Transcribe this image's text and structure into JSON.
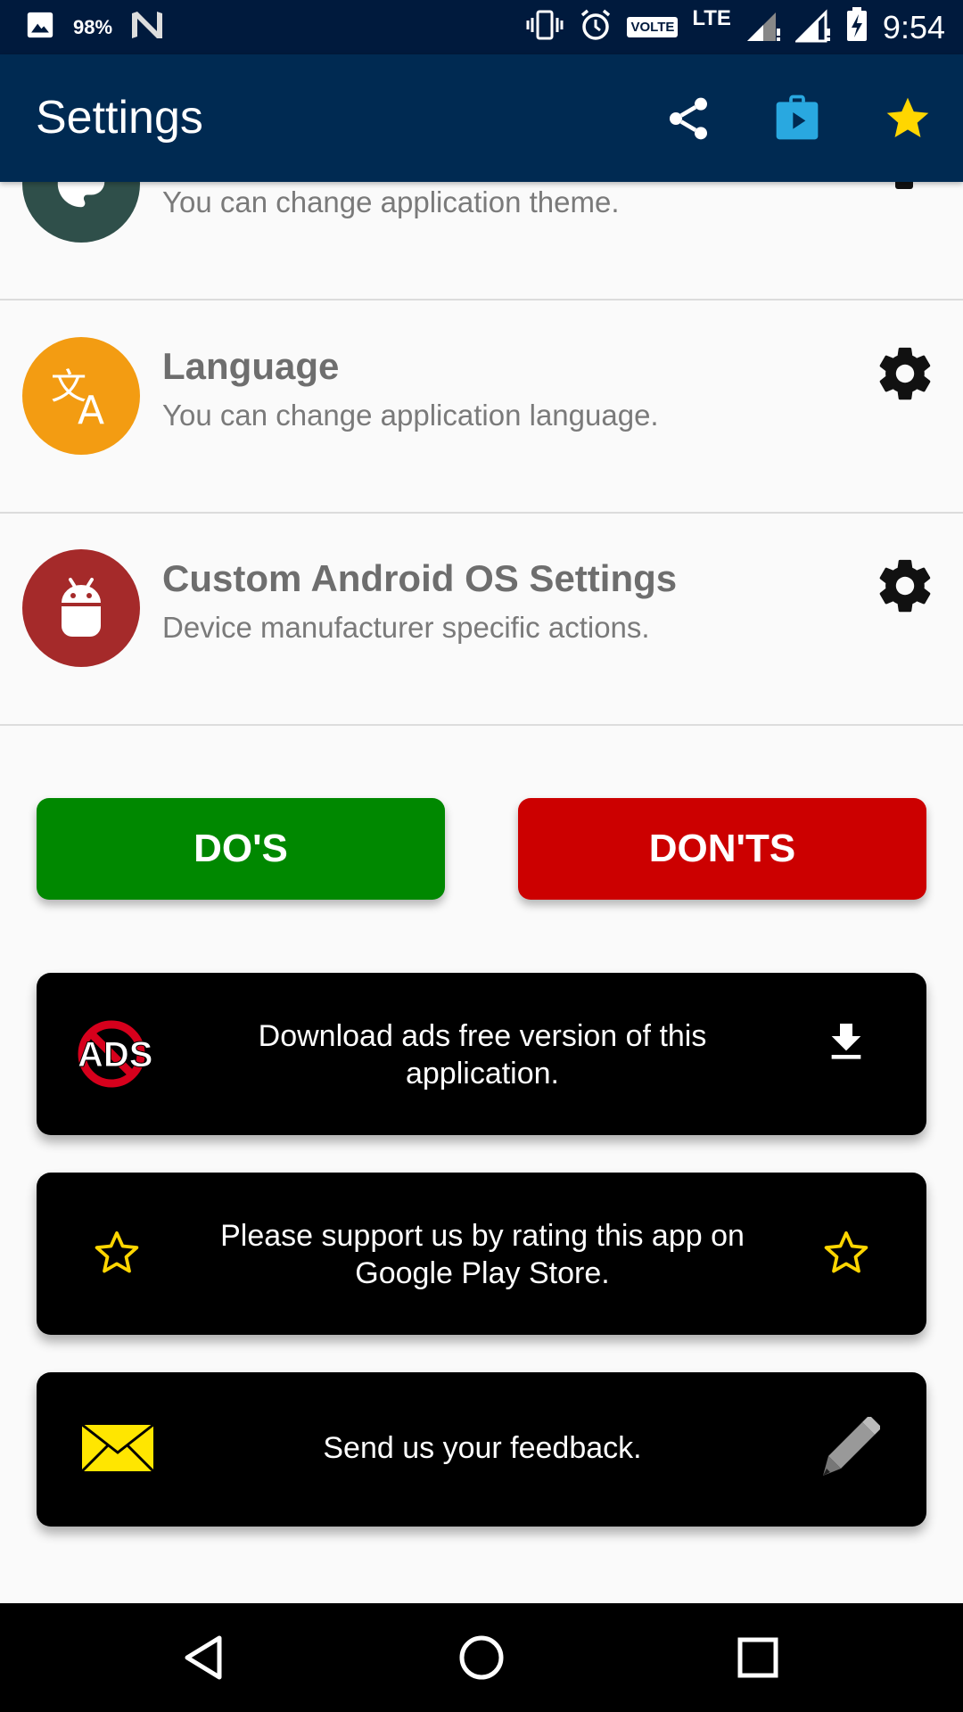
{
  "status_bar": {
    "battery_percent": "98%",
    "volte": "VOLTE",
    "network": "LTE",
    "time": "9:54"
  },
  "app_bar": {
    "title": "Settings",
    "icons": [
      "share-icon",
      "play-store-icon",
      "star-icon"
    ],
    "star_color": "#ffd600",
    "play_color": "#29a8e0"
  },
  "settings": [
    {
      "title": "",
      "subtitle": "You can change application theme.",
      "icon": "palette-icon",
      "icon_bg": "#2f4f4a"
    },
    {
      "title": "Language",
      "subtitle": "You can change application language.",
      "icon": "translate-icon",
      "icon_bg": "#f39c12"
    },
    {
      "title": "Custom Android OS Settings",
      "subtitle": "Device manufacturer specific actions.",
      "icon": "android-icon",
      "icon_bg": "#a52a2a"
    }
  ],
  "buttons": {
    "dos": {
      "label": "DO'S",
      "color": "#008800"
    },
    "donts": {
      "label": "DON'TS",
      "color": "#cc0000"
    }
  },
  "cards": [
    {
      "text": "Download ads free version of this application.",
      "icon_left": "no-ads-icon",
      "icon_left_label": "ADS",
      "icon_right": "download-icon"
    },
    {
      "text": "Please support us by rating this app on Google Play Store.",
      "icon_left": "star-outline-icon",
      "icon_right": "star-outline-icon"
    },
    {
      "text": "Send us your feedback.",
      "icon_left": "mail-icon",
      "icon_right": "pencil-icon"
    }
  ],
  "nav_bar": {
    "icons": [
      "back-icon",
      "home-icon",
      "recents-icon"
    ]
  }
}
